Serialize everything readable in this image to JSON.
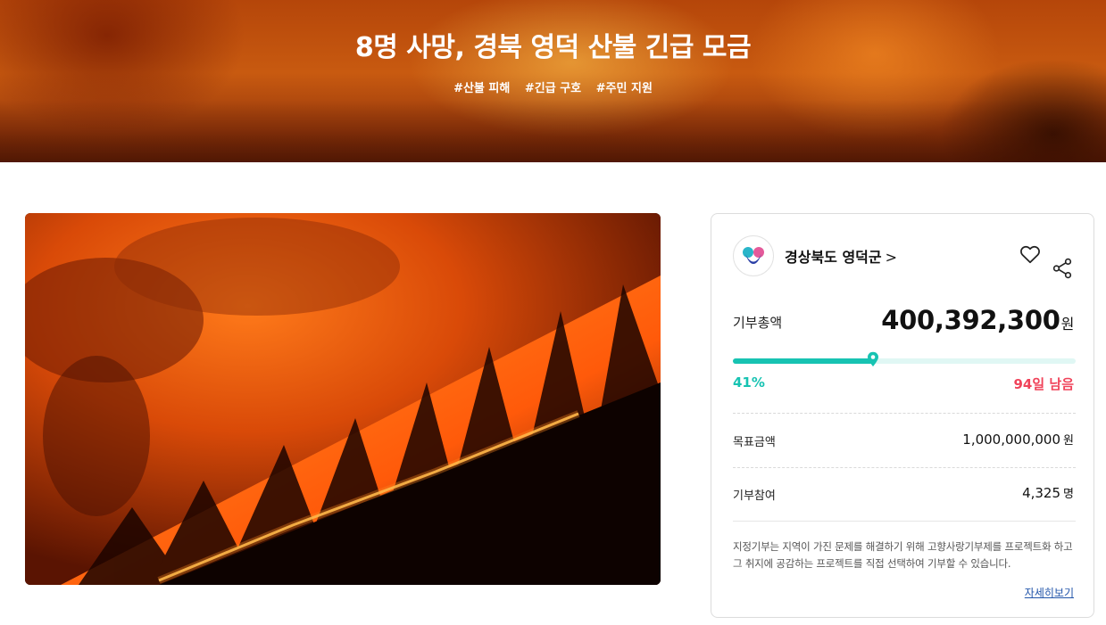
{
  "hero": {
    "title": "8명 사망, 경북 영덕 산불 긴급 모금",
    "tags": [
      "#산불 피해",
      "#긴급 구호",
      "#주민 지원"
    ]
  },
  "panel": {
    "org_name": "경상북도 영덕군",
    "org_chevron": ">",
    "total_label": "기부총액",
    "total_amount": "400,392,300",
    "currency_unit": "원",
    "progress_percent": 41,
    "progress_text": "41%",
    "remaining_text": "94일 남음",
    "goal_label": "목표금액",
    "goal_value": "1,000,000,000",
    "participants_label": "기부참여",
    "participants_value": "4,325",
    "participants_unit": "명",
    "description": "지정기부는 지역이 가진 문제를 해결하기 위해 고향사랑기부제를 프로젝트화 하고 그 취지에 공감하는 프로젝트를 직접 선택하여 기부할 수 있습니다.",
    "more_link": "자세히보기"
  },
  "icons": {
    "heart": "heart-icon",
    "share": "share-icon",
    "org_logo": "yeongdeok-logo",
    "progress_pin": "location-pin-icon"
  },
  "colors": {
    "accent": "#17c3b2",
    "remaining": "#f0435a",
    "link": "#2255aa"
  }
}
